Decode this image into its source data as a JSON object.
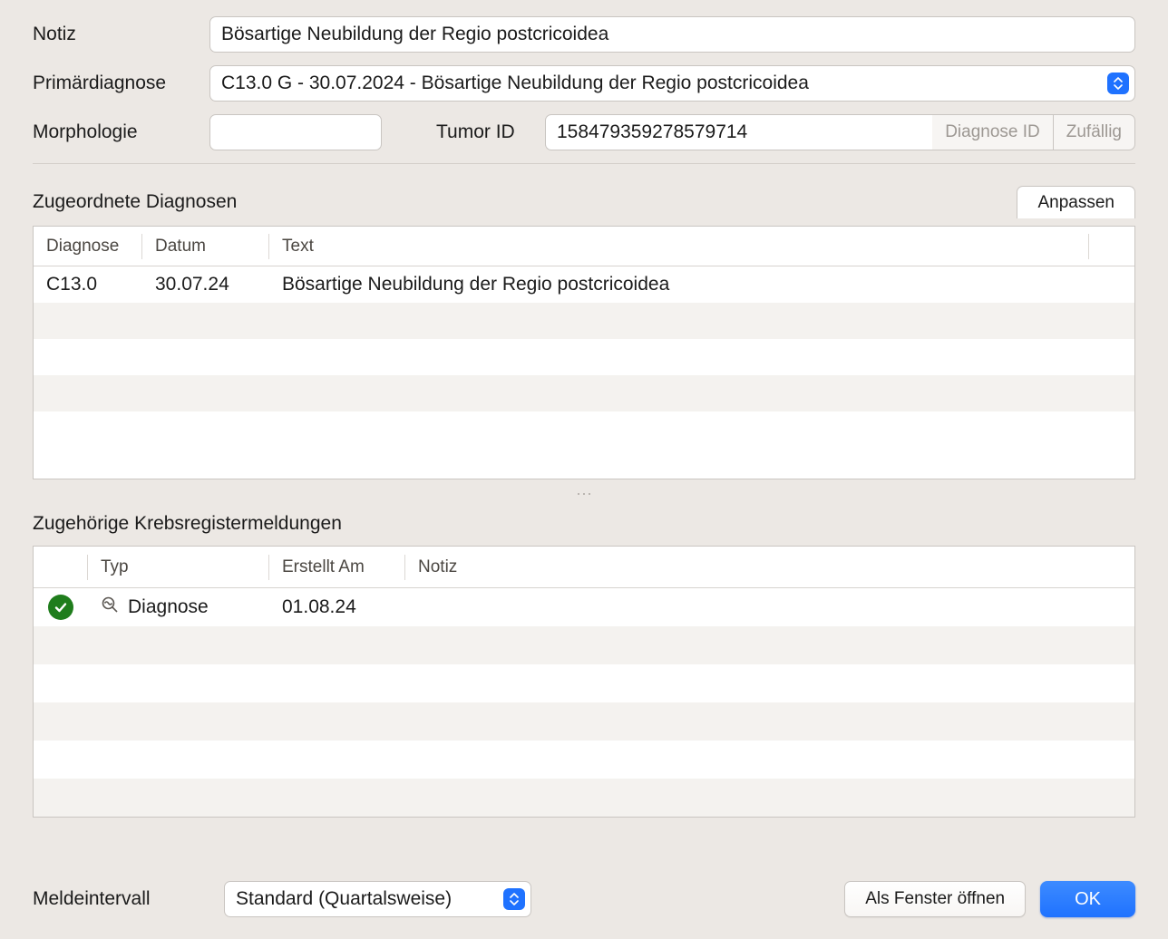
{
  "labels": {
    "notiz": "Notiz",
    "primar": "Primärdiagnose",
    "morph": "Morphologie",
    "tumor_id": "Tumor ID",
    "diagnose_id_btn": "Diagnose ID",
    "zufallig_btn": "Zufällig",
    "zugeordnete": "Zugeordnete Diagnosen",
    "anpassen": "Anpassen",
    "zugehorige": "Zugehörige Krebsregistermeldungen",
    "meldeintervall": "Meldeintervall",
    "als_fenster": "Als Fenster öffnen",
    "ok": "OK"
  },
  "values": {
    "notiz": "Bösartige Neubildung der Regio postcricoidea",
    "primar_selected": "C13.0 G - 30.07.2024 - Bösartige Neubildung der Regio postcricoidea",
    "morph": "",
    "tumor_id": "158479359278579714",
    "meldeintervall_selected": "Standard (Quartalsweise)"
  },
  "diag_table": {
    "headers": {
      "diagnose": "Diagnose",
      "datum": "Datum",
      "text": "Text"
    },
    "rows": [
      {
        "diagnose": "C13.0",
        "datum": "30.07.24",
        "text": "Bösartige Neubildung der Regio postcricoidea"
      }
    ]
  },
  "meldungen_table": {
    "headers": {
      "typ": "Typ",
      "erstellt": "Erstellt Am",
      "notiz": "Notiz"
    },
    "rows": [
      {
        "status": "ok",
        "typ": "Diagnose",
        "erstellt": "01.08.24",
        "notiz": ""
      }
    ]
  }
}
